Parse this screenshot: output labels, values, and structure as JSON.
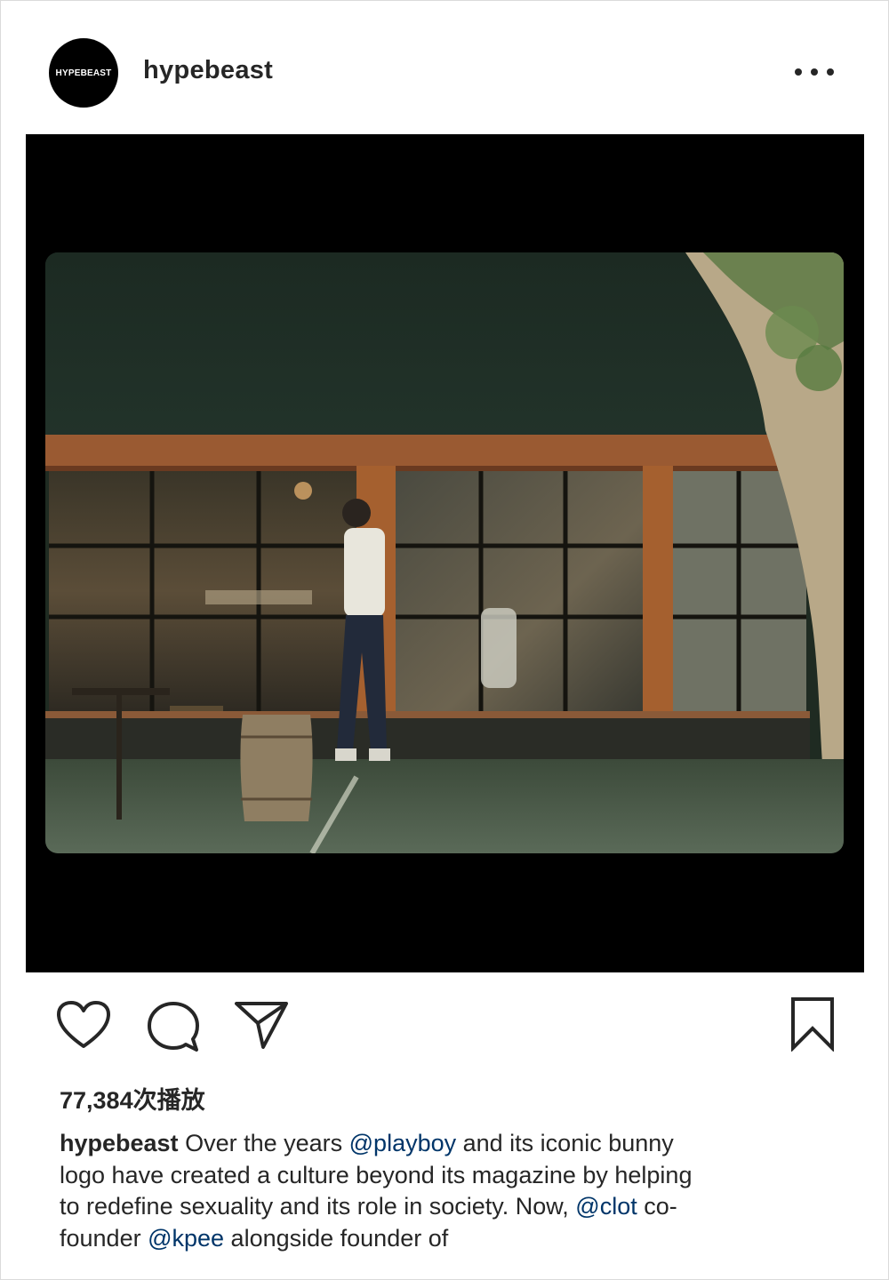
{
  "header": {
    "avatar_text": "HYPEBEAST",
    "username": "hypebeast"
  },
  "media": {
    "type": "video",
    "description_icon": "video-frame"
  },
  "actions": {
    "like_icon": "heart-icon",
    "comment_icon": "comment-icon",
    "share_icon": "send-icon",
    "save_icon": "bookmark-icon"
  },
  "stats": {
    "views": "77,384次播放"
  },
  "caption": {
    "username": "hypebeast",
    "text_1": " Over the years ",
    "mention_1": "@playboy",
    "text_2": " and its iconic bunny",
    "line_2": "logo have created a culture beyond its magazine by helping",
    "line_3_a": "to redefine sexuality and its role in society. Now, ",
    "mention_2": "@clot",
    "line_3_b": " co-",
    "line_4_a": "founder ",
    "mention_3": "@kpee",
    "line_4_b": " alongside founder of"
  },
  "colors": {
    "text": "#262626",
    "mention": "#003569",
    "media_bg": "#000000",
    "border": "#dbdbdb"
  }
}
